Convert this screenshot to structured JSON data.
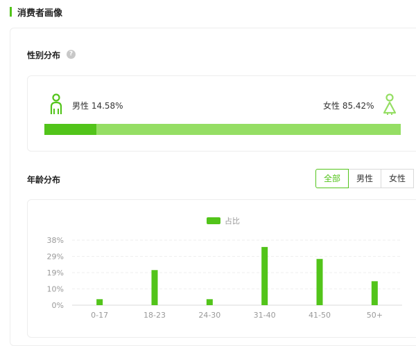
{
  "section": {
    "title": "消费者画像"
  },
  "gender": {
    "title": "性别分布",
    "help_glyph": "?",
    "male_label": "男性 14.58%",
    "female_label": "女性 85.42%",
    "male_ratio": 0.1458,
    "female_ratio": 0.8542,
    "icons": {
      "male": "male-person-icon",
      "female": "female-person-icon",
      "help": "question-circle-icon"
    },
    "colors": {
      "male": "#52c41a",
      "female": "#95de64"
    }
  },
  "age": {
    "title": "年龄分布",
    "tabs": [
      {
        "label": "全部",
        "active": true
      },
      {
        "label": "男性",
        "active": false
      },
      {
        "label": "女性",
        "active": false
      }
    ]
  },
  "chart_data": {
    "type": "bar",
    "categories": [
      "0-17",
      "18-23",
      "24-30",
      "31-40",
      "41-50",
      "50+"
    ],
    "series": [
      {
        "name": "占比",
        "values": [
          3.5,
          20.5,
          3.5,
          34,
          27,
          14
        ],
        "color": "#52c41a"
      }
    ],
    "y_ticks": [
      "0%",
      "10%",
      "19%",
      "29%",
      "38%"
    ],
    "ylim": [
      0,
      38
    ],
    "legend_position": "top-center",
    "grid": true
  }
}
